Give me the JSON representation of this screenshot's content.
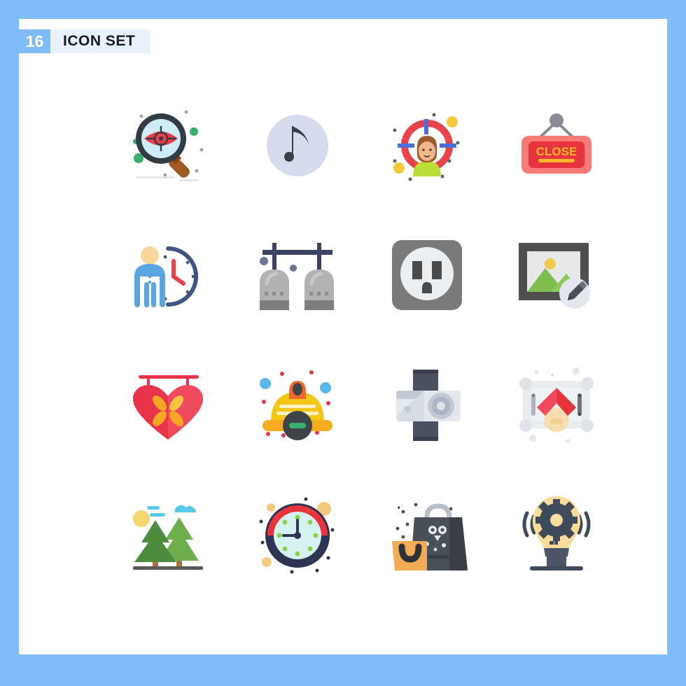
{
  "page": {
    "background_color": "#7fbbf7",
    "sheet_color": "#ffffff"
  },
  "header": {
    "count": "16",
    "title": "ICON SET",
    "badge_color": "#7fbbf7",
    "strip_color": "#e8f2fc",
    "badge_text_color": "#ffffff",
    "title_text_color": "#1b1b1b"
  },
  "grid": {
    "columns": 4,
    "rows": 4,
    "total_icons": 16
  },
  "icons": [
    {
      "index": 1,
      "name": "eye-target-search-icon",
      "label": "Magnifier with target eye",
      "colors": {
        "glass": "#cdecf5",
        "ring": "#333b44",
        "handle": "#a05a26",
        "eye": "#ef3e4a",
        "accent": "#3aaf6d"
      }
    },
    {
      "index": 2,
      "name": "music-note-icon",
      "label": "Music note in circle",
      "colors": {
        "circle": "#d6dced",
        "note": "#3a3f46"
      }
    },
    {
      "index": 3,
      "name": "target-woman-icon",
      "label": "Woman inside crosshair target",
      "colors": {
        "ring": "#e8434a",
        "crosshair": "#4a6fd6",
        "hair": "#9c5c2e",
        "shirt": "#b9dd36",
        "skin": "#f2b78a",
        "dot": "#f4c73c"
      }
    },
    {
      "index": 4,
      "name": "close-sign-icon",
      "label": "Hanging CLOSE sign",
      "text": "CLOSE",
      "colors": {
        "plate_outer": "#f77a76",
        "plate_inner": "#e8343c",
        "text": "#f9b62f",
        "hanger": "#8b8b93"
      }
    },
    {
      "index": 5,
      "name": "person-clock-time-icon",
      "label": "Person with clock",
      "colors": {
        "body": "#5ba5e0",
        "head": "#f7d79b",
        "clock": "#3f5480",
        "hands": "#e8434a"
      }
    },
    {
      "index": 6,
      "name": "pendant-lamps-icon",
      "label": "Two hanging pendant lamps on rail",
      "colors": {
        "rail": "#3b4263",
        "lamp": "#b2b2b2",
        "lamp_base": "#7d7d7d",
        "bead": "#6d7793"
      }
    },
    {
      "index": 7,
      "name": "power-socket-icon",
      "label": "Electrical wall socket",
      "colors": {
        "plate": "#7a7a7a",
        "face": "#eceff1",
        "slots": "#4a4a4a"
      }
    },
    {
      "index": 8,
      "name": "edit-image-icon",
      "label": "Photo frame with edit pencil",
      "colors": {
        "frame": "#4f4f4f",
        "sky": "#e6e8ea",
        "mountains": "#7fbd4f",
        "sun": "#f2c94c",
        "badge": "#e3e6ef",
        "pencil": "#4a4f58"
      }
    },
    {
      "index": 9,
      "name": "heart-sign-flower-icon",
      "label": "Hanging heart sign with flower",
      "colors": {
        "heart": "#e8334a",
        "heart_light": "#ef4b5c",
        "flower": "#f5a623",
        "flower_light": "#f7c440",
        "rail": "#e8334a"
      }
    },
    {
      "index": 10,
      "name": "helmet-remove-icon",
      "label": "Safety helmet with remove badge",
      "colors": {
        "helmet": "#f5c518",
        "lamp": "#ef6a2a",
        "badge": "#3f4448",
        "minus": "#3aaf6d",
        "dot_red": "#e8334a",
        "dot_blue": "#5bb6e8"
      }
    },
    {
      "index": 11,
      "name": "wrist-camera-icon",
      "label": "Action camera with strap",
      "colors": {
        "body": "#e3e7ee",
        "body_shade": "#c3c9d4",
        "lens": "#aeb5c2",
        "strap": "#4a5160"
      }
    },
    {
      "index": 12,
      "name": "framed-house-picture-icon",
      "label": "Framed house picture",
      "colors": {
        "frame": "#e9ecef",
        "roof": "#e8434a",
        "roof_light": "#f26b72",
        "house": "#f7deb0",
        "pin": "#6c737d"
      }
    },
    {
      "index": 13,
      "name": "pine-trees-nature-icon",
      "label": "Pine trees with sun and clouds",
      "colors": {
        "tree_dark": "#4d8c3f",
        "tree_light": "#6fae4c",
        "trunk": "#a9713e",
        "sun": "#f5d76e",
        "cloud": "#5bc8e8",
        "ground": "#5a5a5a"
      }
    },
    {
      "index": 14,
      "name": "alarm-clock-icon",
      "label": "Clock with red arc",
      "colors": {
        "ring": "#2e3553",
        "arc": "#e8343c",
        "face": "#d6f2f0",
        "markers": "#8ad14a",
        "dot_yellow": "#f5c97b"
      }
    },
    {
      "index": 15,
      "name": "shopping-bags-icon",
      "label": "Shopping bags with skull motif",
      "colors": {
        "bag_dark": "#4a5058",
        "bag_dark_side": "#3b4047",
        "bag_orange": "#f5ab53",
        "handle": "#b9bfc9",
        "motif": "#e8ebef"
      }
    },
    {
      "index": 16,
      "name": "idea-gear-bulb-icon",
      "label": "Light bulb with gear",
      "colors": {
        "bulb": "#f7dc9a",
        "gear": "#3f4a5a",
        "base": "#4a5566"
      }
    }
  ]
}
